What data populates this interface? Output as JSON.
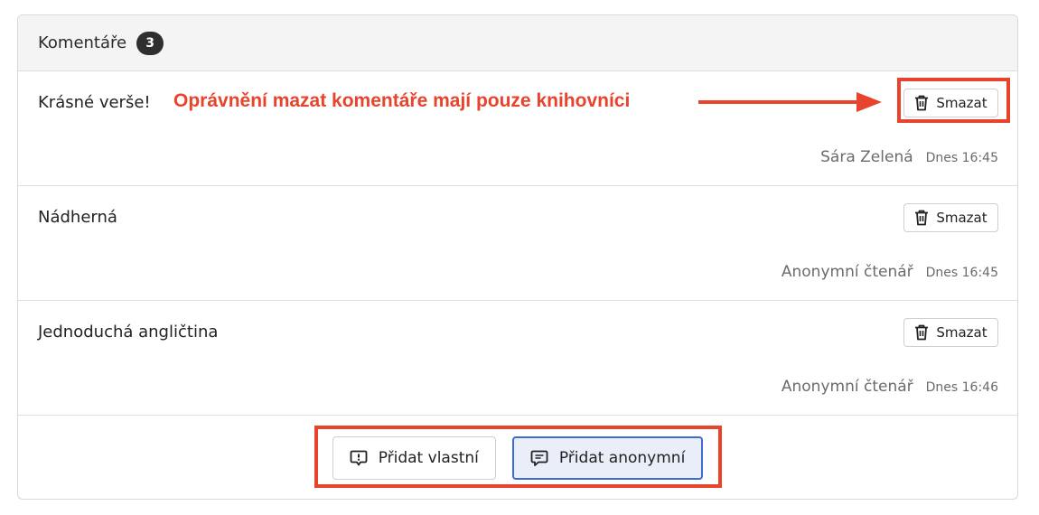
{
  "header": {
    "title": "Komentáře",
    "count": "3"
  },
  "comments": [
    {
      "text": "Krásné verše!",
      "author": "Sára Zelená",
      "time": "Dnes 16:45",
      "delete_label": "Smazat"
    },
    {
      "text": "Nádherná",
      "author": "Anonymní čtenář",
      "time": "Dnes 16:45",
      "delete_label": "Smazat"
    },
    {
      "text": "Jednoduchá angličtina",
      "author": "Anonymní čtenář",
      "time": "Dnes 16:46",
      "delete_label": "Smazat"
    }
  ],
  "footer": {
    "add_own_label": "Přidat vlastní",
    "add_anonymous_label": "Přidat anonymní"
  },
  "annotation": {
    "text": "Oprávnění mazat komentáře mají pouze knihovníci",
    "color": "#e8432c"
  },
  "icons": {
    "delete": "trash-icon",
    "add_own": "comment-alert-icon",
    "add_anonymous": "comment-lines-icon"
  },
  "colors": {
    "badge": "#2f2f2f",
    "primary_border": "#3d6cd1",
    "annotation": "#e8432c"
  }
}
